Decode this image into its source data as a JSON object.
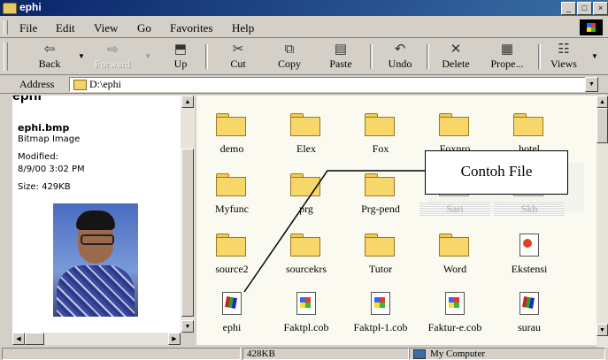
{
  "window": {
    "title": "ephi"
  },
  "menu": {
    "items": [
      "File",
      "Edit",
      "View",
      "Go",
      "Favorites",
      "Help"
    ]
  },
  "toolbar": {
    "buttons": [
      "Back",
      "Forward",
      "Up",
      "Cut",
      "Copy",
      "Paste",
      "Undo",
      "Delete",
      "Prope...",
      "Views"
    ]
  },
  "address": {
    "label": "Address",
    "value": "D:\\ephi"
  },
  "preview": {
    "folder_title": "ephi",
    "filename": "ephi.bmp",
    "type": "Bitmap Image",
    "modified_label": "Modified:",
    "modified_date": "8/9/00 3:02 PM",
    "size": "Size: 429KB"
  },
  "items": [
    {
      "label": "demo",
      "icon": "folder-icon"
    },
    {
      "label": "Elex",
      "icon": "folder-icon"
    },
    {
      "label": "Fox",
      "icon": "folder-icon"
    },
    {
      "label": "Foxpro",
      "icon": "folder-icon"
    },
    {
      "label": "hotel",
      "icon": "folder-icon"
    },
    {
      "label": "Myfunc",
      "icon": "folder-icon"
    },
    {
      "label": "prg",
      "icon": "folder-icon"
    },
    {
      "label": "Prg-pend",
      "icon": "folder-icon"
    },
    {
      "label": "Sari",
      "icon": "folder-icon"
    },
    {
      "label": "Skh",
      "icon": "folder-icon"
    },
    {
      "label": "source2",
      "icon": "folder-icon"
    },
    {
      "label": "sourcekrs",
      "icon": "folder-icon"
    },
    {
      "label": "Tutor",
      "icon": "folder-icon"
    },
    {
      "label": "Word",
      "icon": "folder-icon"
    },
    {
      "label": "Ekstensi",
      "icon": "ppt-file-icon"
    },
    {
      "label": "ephi",
      "icon": "exe-file-icon"
    },
    {
      "label": "Faktpl.cob",
      "icon": "cob-file-icon"
    },
    {
      "label": "Faktpl-1.cob",
      "icon": "cob-file-icon"
    },
    {
      "label": "Faktur-e.cob",
      "icon": "cob-file-icon"
    },
    {
      "label": "surau",
      "icon": "exe-file-icon"
    }
  ],
  "annotation": {
    "text": "Contoh File"
  },
  "status": {
    "size": "428KB",
    "zone": "My Computer"
  }
}
